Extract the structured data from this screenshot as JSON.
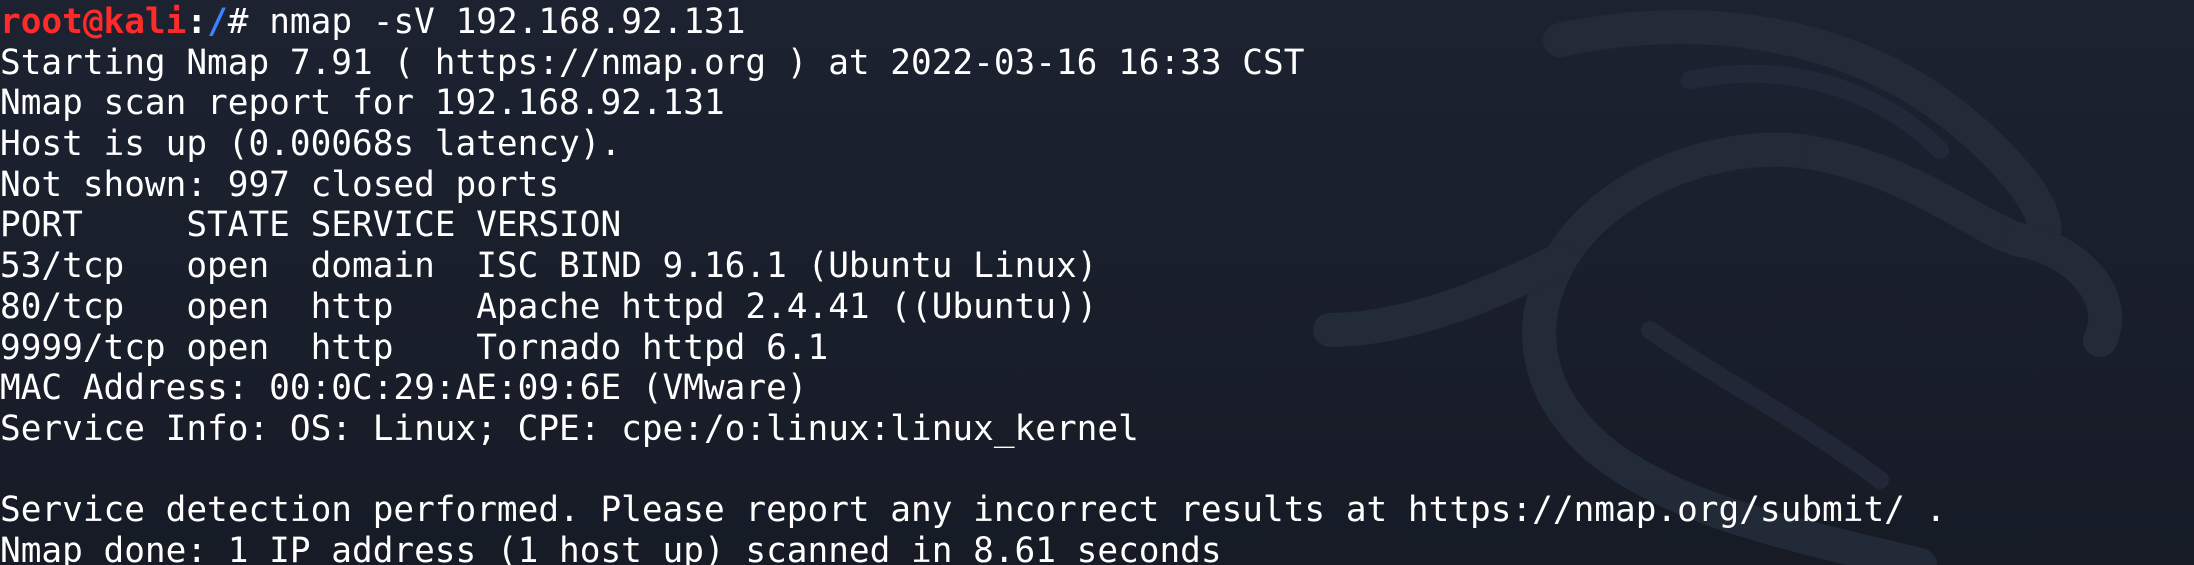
{
  "prompt": {
    "user_host": "root@kali",
    "colon": ":",
    "path": "/",
    "symbol": "# ",
    "command": "nmap -sV 192.168.92.131"
  },
  "output": [
    "Starting Nmap 7.91 ( https://nmap.org ) at 2022-03-16 16:33 CST",
    "Nmap scan report for 192.168.92.131",
    "Host is up (0.00068s latency).",
    "Not shown: 997 closed ports",
    "PORT     STATE SERVICE VERSION",
    "53/tcp   open  domain  ISC BIND 9.16.1 (Ubuntu Linux)",
    "80/tcp   open  http    Apache httpd 2.4.41 ((Ubuntu))",
    "9999/tcp open  http    Tornado httpd 6.1",
    "MAC Address: 00:0C:29:AE:09:6E (VMware)",
    "Service Info: OS: Linux; CPE: cpe:/o:linux:linux_kernel",
    "",
    "Service detection performed. Please report any incorrect results at https://nmap.org/submit/ .",
    "Nmap done: 1 IP address (1 host up) scanned in 8.61 seconds"
  ],
  "colors": {
    "background": "#1a1f2b",
    "user_host": "#ff2a2a",
    "path": "#3b82ff",
    "text": "#ffffff"
  },
  "background_icon": "kali-dragon-icon"
}
